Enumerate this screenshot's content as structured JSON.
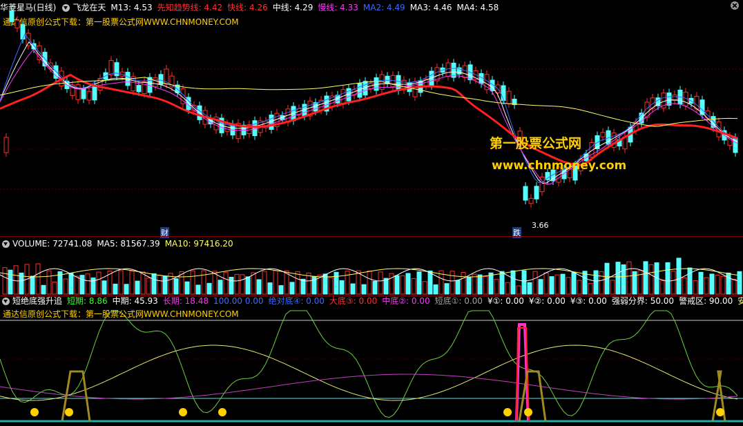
{
  "main_panel": {
    "stock_name": "华菱星马(日线)",
    "indicator_name": "飞龙在天",
    "ma_values": [
      {
        "label": "M13:",
        "value": "4.53",
        "color": "#ffffff"
      },
      {
        "label": "先知趋势线:",
        "value": "4.42",
        "color": "#ff3030"
      },
      {
        "label": "快线:",
        "value": "4.26",
        "color": "#ff3030"
      },
      {
        "label": "中线:",
        "value": "4.29",
        "color": "#ffffff"
      },
      {
        "label": "慢线:",
        "value": "4.33",
        "color": "#ff33ff"
      },
      {
        "label": "MA2:",
        "value": "4.49",
        "color": "#3b6bff"
      },
      {
        "label": "MA3:",
        "value": "4.46",
        "color": "#ffffff"
      },
      {
        "label": "MA4:",
        "value": "4.58",
        "color": "#ffffff"
      }
    ],
    "promo_text": "通达信原创公式下载：第一股票公式网WWW.CHNMONEY.COM",
    "watermark_title": "第一股票公式网",
    "watermark_url": "www.chnmoney.com",
    "low_price_label": "3.66",
    "marker_cai": "财",
    "marker_die": "跌"
  },
  "volume_panel": {
    "items": [
      {
        "label": "VOLUME:",
        "value": "72741.08",
        "color": "#ffffff"
      },
      {
        "label": "MA5:",
        "value": "81567.39",
        "color": "#ffffff"
      },
      {
        "label": "MA10:",
        "value": "97416.20",
        "color": "#ffff66"
      }
    ]
  },
  "indicator_panel": {
    "name": "短绝底强升追",
    "items": [
      {
        "label": "短期:",
        "value": "8.86",
        "color": "#33ff33"
      },
      {
        "label": "中期:",
        "value": "45.93",
        "color": "#ffffff"
      },
      {
        "label": "长期:",
        "value": "18.48",
        "color": "#ff33ff"
      },
      {
        "label": "100.00",
        "value": "0.00",
        "color": "#3b6bff"
      },
      {
        "label": "绝对底④:",
        "value": "0.00",
        "color": "#3b6bff"
      },
      {
        "label": "大底③:",
        "value": "0.00",
        "color": "#ff3030"
      },
      {
        "label": "中底②:",
        "value": "0.00",
        "color": "#ff33ff"
      },
      {
        "label": "短底①:",
        "value": "0.00",
        "color": "#a0a0a0"
      },
      {
        "label": "¥①:",
        "value": "0.00",
        "color": "#ffffff"
      },
      {
        "label": "¥②:",
        "value": "0.00",
        "color": "#ffffff"
      },
      {
        "label": "¥③:",
        "value": "0.00",
        "color": "#ffffff"
      },
      {
        "label": "强弱分界:",
        "value": "50.00",
        "color": "#ffffff"
      },
      {
        "label": "警戒区:",
        "value": "90.00",
        "color": "#ffffff"
      },
      {
        "label": "安全",
        "value": "",
        "color": "#ffff66"
      }
    ],
    "promo_text": "通达信原创公式下载：第一股票公式网WWW.CHNMONEY.COM",
    "circle_markers": [
      "①",
      "②",
      "③"
    ]
  }
}
